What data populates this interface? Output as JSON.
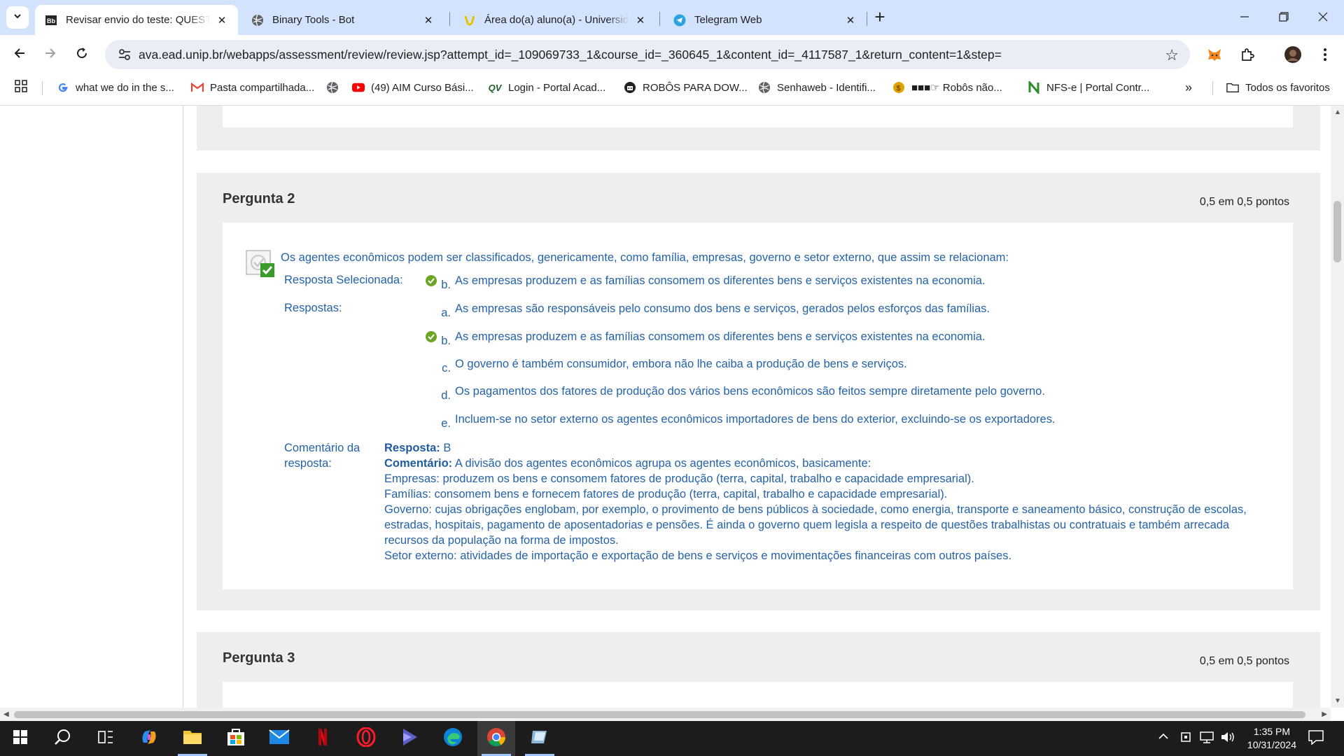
{
  "browser": {
    "tabs": [
      {
        "title": "Revisar envio do teste: QUESTIONÁRIO",
        "active": true,
        "icon": "blackboard-icon"
      },
      {
        "title": "Binary Tools - Bot",
        "active": false,
        "icon": "globe-icon"
      },
      {
        "title": "Área do(a) aluno(a) - Universidade",
        "active": false,
        "icon": "unip-icon"
      },
      {
        "title": "Telegram Web",
        "active": false,
        "icon": "telegram-icon"
      }
    ],
    "close_glyph": "✕",
    "new_tab_glyph": "+",
    "url": "ava.ead.unip.br/webapps/assessment/review/review.jsp?attempt_id=_109069733_1&course_id=_360645_1&content_id=_4117587_1&return_content=1&step=",
    "bookmarks": [
      {
        "label": "what we do in the s...",
        "icon": "google-icon"
      },
      {
        "label": "Pasta compartilhada...",
        "icon": "gmail-icon"
      },
      {
        "label": "",
        "icon": "globe-icon"
      },
      {
        "label": "(49) AIM Curso Bási...",
        "icon": "youtube-icon"
      },
      {
        "label": "Login - Portal Acad...",
        "icon": "qv-icon"
      },
      {
        "label": "ROBÔS PARA DOW...",
        "icon": "robot-icon"
      },
      {
        "label": "Senhaweb - Identifi...",
        "icon": "globe-icon"
      },
      {
        "label": "■■■☞ Robôs não...",
        "icon": "coin-icon"
      },
      {
        "label": "NFS-e | Portal Contr...",
        "icon": "nfse-icon"
      }
    ],
    "bookmarks_overflow": "»",
    "all_bookmarks": "Todos os favoritos"
  },
  "question2": {
    "title": "Pergunta 2",
    "points": "0,5 em 0,5 pontos",
    "text": "Os agentes econômicos podem ser classificados, genericamente, como família, empresas, governo e setor externo, que assim se relacionam:",
    "selected_label": "Resposta Selecionada:",
    "selected_letter": "b.",
    "selected_text": "As empresas produzem e as famílias consomem os diferentes bens e serviços existentes na economia.",
    "answers_label": "Respostas:",
    "answers": [
      {
        "letter": "a.",
        "text": "As empresas são responsáveis pelo consumo dos bens e serviços, gerados pelos esforços das famílias.",
        "correct": false
      },
      {
        "letter": "b.",
        "text": "As empresas produzem e as famílias consomem os diferentes bens e serviços existentes na economia.",
        "correct": true
      },
      {
        "letter": "c.",
        "text": "O governo é também consumidor, embora não lhe caiba a produção de bens e serviços.",
        "correct": false
      },
      {
        "letter": "d.",
        "text": "Os pagamentos dos fatores de produção dos vários bens econômicos são feitos sempre diretamente pelo governo.",
        "correct": false
      },
      {
        "letter": "e.",
        "text": "Incluem-se no setor externo os agentes econômicos importadores de bens do exterior, excluindo-se os exportadores.",
        "correct": false
      }
    ],
    "comment_label_1": "Comentário da",
    "comment_label_2": "resposta:",
    "comment": {
      "answer_label": "Resposta:",
      "answer_value": " B",
      "comment_label": "Comentário:",
      "comment_intro": " A divisão dos agentes econômicos agrupa os agentes econômicos, basicamente:",
      "lines": [
        "Empresas: produzem os bens e consomem fatores de produção (terra, capital, trabalho e capacidade empresarial).",
        "Famílias: consomem bens e fornecem fatores de produção (terra, capital, trabalho e capacidade empresarial).",
        "Governo: cujas obrigações englobam, por exemplo, o provimento de bens públicos à sociedade, como energia, transporte e saneamento básico, construção de escolas, estradas, hospitais, pagamento de aposentadorias e pensões. É ainda o governo quem legisla a respeito de questões trabalhistas ou contratuais e também arrecada recursos da população na forma de impostos.",
        "Setor externo: atividades de importação e exportação de bens e serviços e movimentações financeiras com outros países."
      ]
    }
  },
  "question3": {
    "title": "Pergunta 3",
    "points": "0,5 em 0,5 pontos"
  },
  "taskbar": {
    "time": "1:35 PM",
    "date": "10/31/2024"
  },
  "colors": {
    "tab_strip": "#d3e3fd",
    "link_blue": "#2563a6",
    "check_green": "#6aa621"
  }
}
